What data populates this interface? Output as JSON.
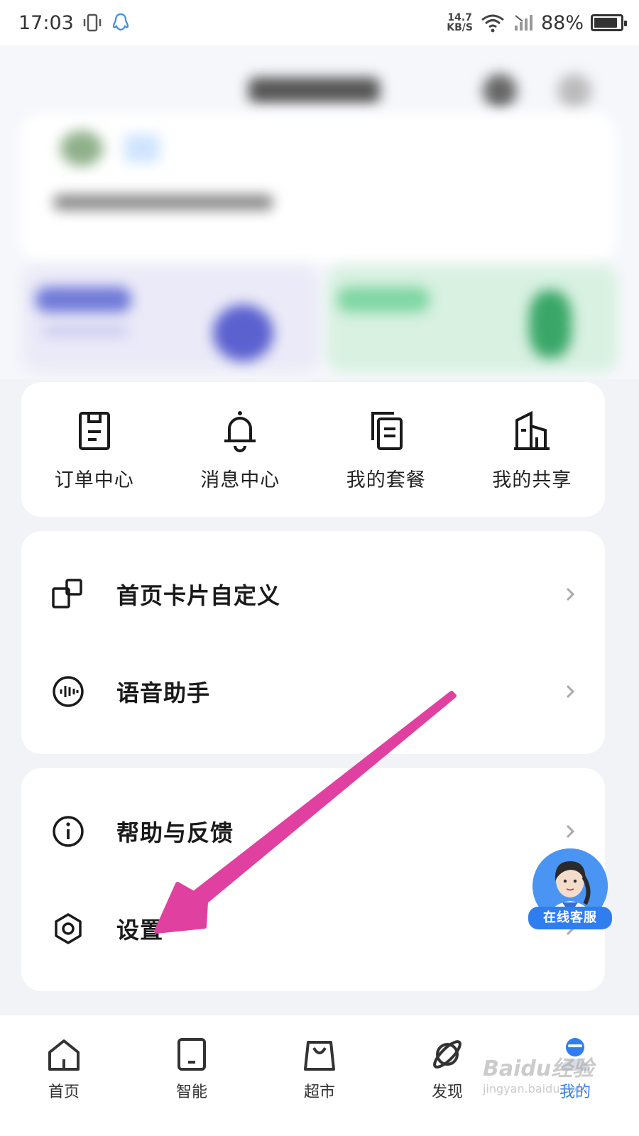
{
  "status_bar": {
    "time": "17:03",
    "net_speed_value": "14.7",
    "net_speed_unit": "KB/S",
    "battery": "88%",
    "battery_level": 0.88
  },
  "quick_actions": [
    {
      "label": "订单中心",
      "icon": "order-clipboard-icon"
    },
    {
      "label": "消息中心",
      "icon": "bell-icon"
    },
    {
      "label": "我的套餐",
      "icon": "package-copy-icon"
    },
    {
      "label": "我的共享",
      "icon": "share-building-icon"
    }
  ],
  "list_group_1": [
    {
      "label": "首页卡片自定义",
      "icon": "cards-customize-icon"
    },
    {
      "label": "语音助手",
      "icon": "voice-waveform-icon"
    }
  ],
  "list_group_2": [
    {
      "label": "帮助与反馈",
      "icon": "info-icon"
    },
    {
      "label": "设置",
      "icon": "hexagon-settings-icon"
    }
  ],
  "support": {
    "label": "在线客服"
  },
  "tabs": [
    {
      "label": "首页",
      "icon": "home-icon",
      "active": false
    },
    {
      "label": "智能",
      "icon": "tablet-icon",
      "active": false
    },
    {
      "label": "超市",
      "icon": "shopping-bag-icon",
      "active": false
    },
    {
      "label": "发现",
      "icon": "planet-icon",
      "active": false
    },
    {
      "label": "我的",
      "icon": "profile-icon",
      "active": true
    }
  ],
  "watermark": {
    "text": "Baidu经验",
    "sub": "jingyan.baidu.com"
  },
  "colors": {
    "accent": "#2f7ef0",
    "arrow": "#e040a0",
    "background": "#f2f3f7"
  }
}
